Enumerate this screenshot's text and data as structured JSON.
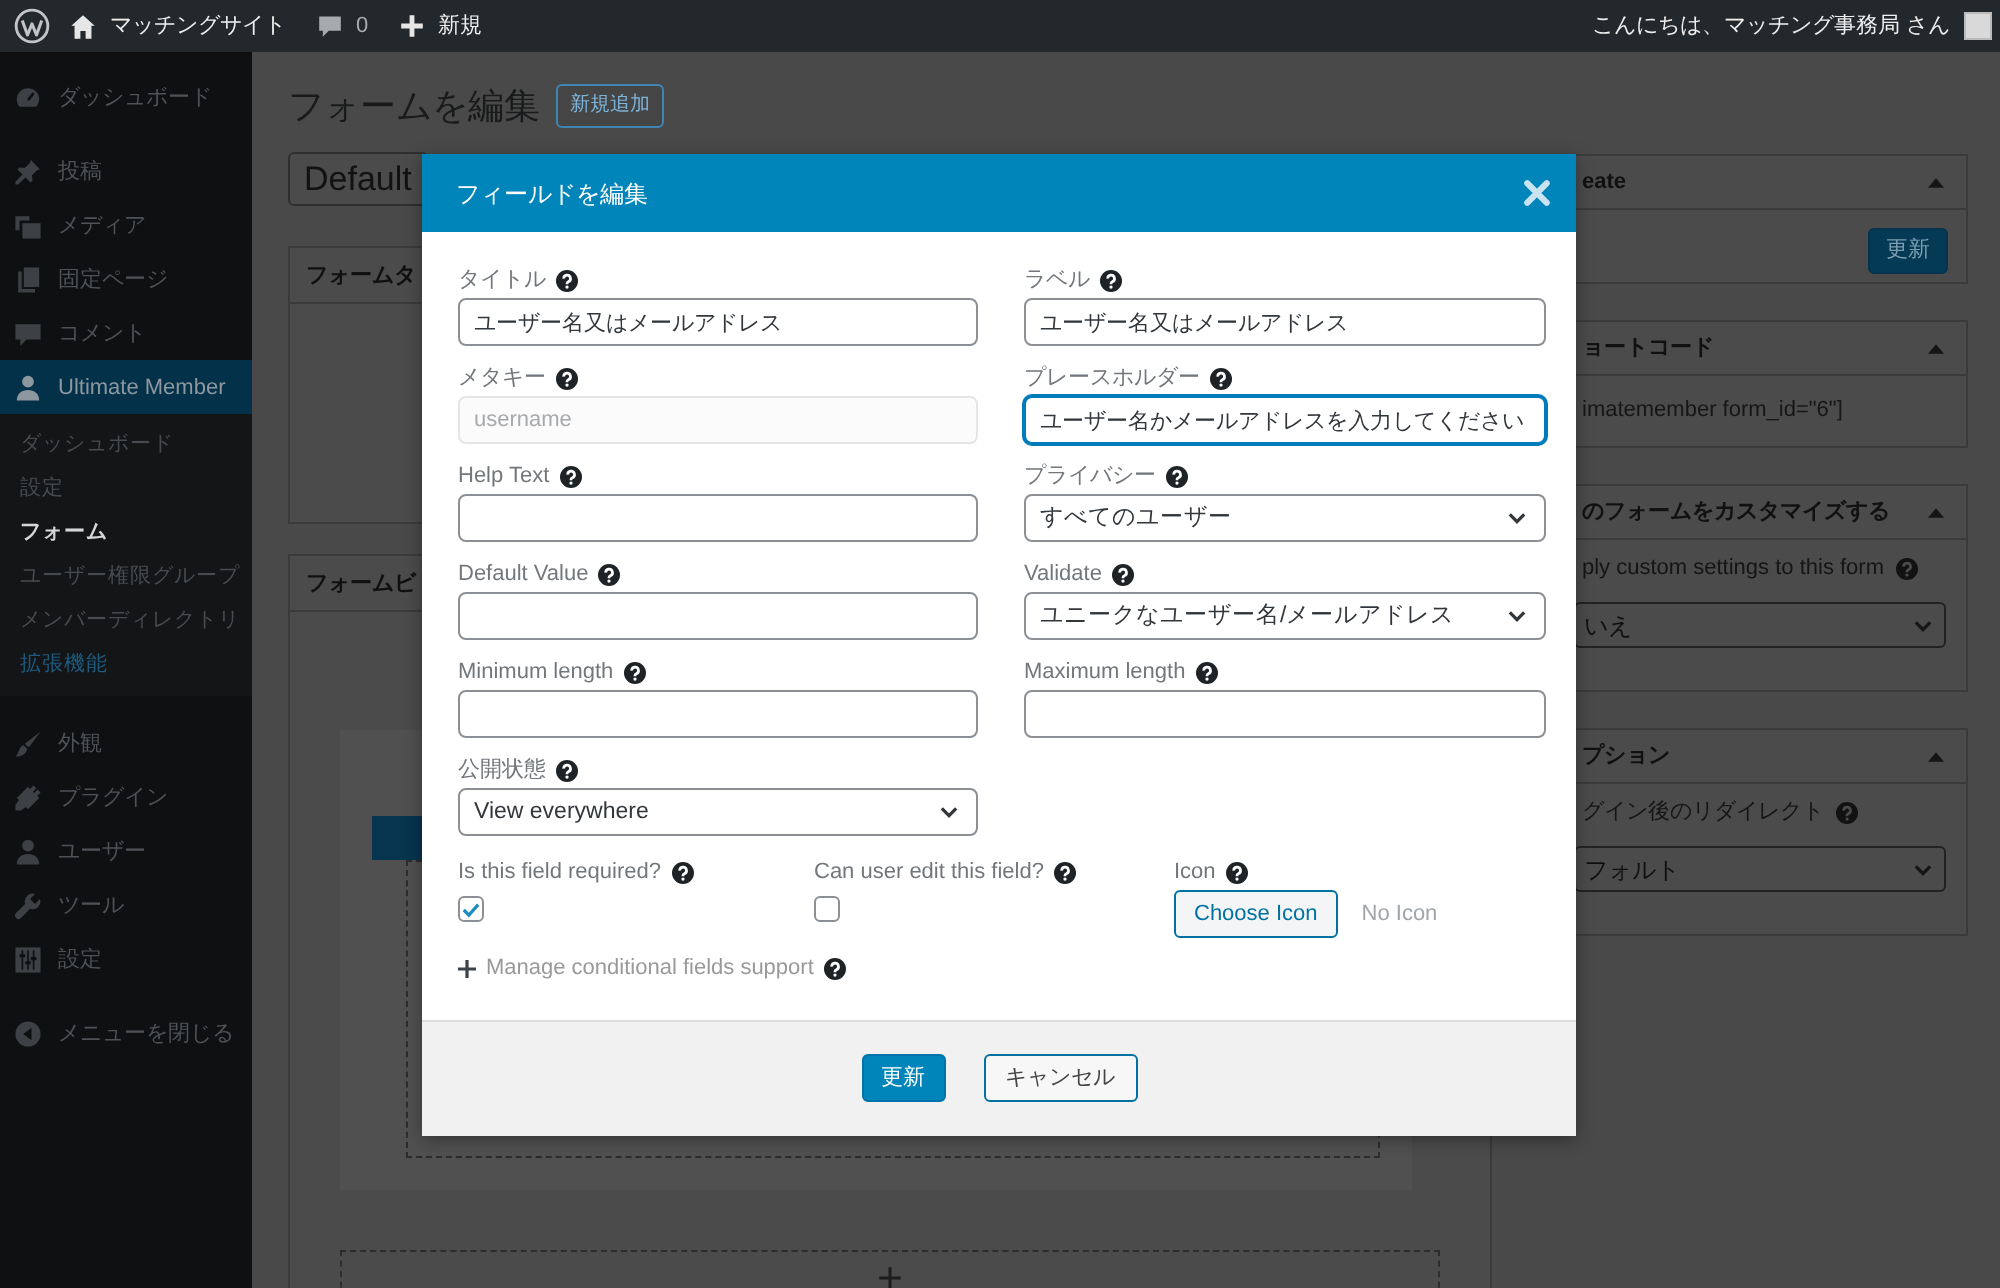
{
  "admin_bar": {
    "site_name": "マッチングサイト",
    "comments": "0",
    "new": "新規",
    "greeting": "こんにちは、マッチング事務局 さん"
  },
  "sidebar": {
    "groups": [
      [
        {
          "label": "ダッシュボード",
          "selected": false
        }
      ],
      [
        {
          "label": "投稿",
          "selected": false
        },
        {
          "label": "メディア",
          "selected": false
        },
        {
          "label": "固定ページ",
          "selected": false
        },
        {
          "label": "コメント",
          "selected": false
        },
        {
          "label": "Ultimate Member",
          "selected": true,
          "children": [
            {
              "label": "ダッシュボード",
              "selected": false,
              "highlighted": false
            },
            {
              "label": "設定",
              "selected": false,
              "highlighted": false
            },
            {
              "label": "フォーム",
              "selected": true,
              "highlighted": false
            },
            {
              "label": "ユーザー権限グループ",
              "selected": false,
              "highlighted": false
            },
            {
              "label": "メンバーディレクトリ",
              "selected": false,
              "highlighted": false
            },
            {
              "label": "拡張機能",
              "selected": false,
              "highlighted": true
            }
          ]
        }
      ],
      [
        {
          "label": "外観",
          "selected": false
        },
        {
          "label": "プラグイン",
          "selected": false
        },
        {
          "label": "ユーザー",
          "selected": false
        },
        {
          "label": "ツール",
          "selected": false
        },
        {
          "label": "設定",
          "selected": false
        }
      ]
    ],
    "collapse": "メニューを閉じる"
  },
  "page": {
    "title": "フォームを編集",
    "add_new": "新規追加",
    "form_title": "Default",
    "panels": [
      {
        "kind": "plain",
        "title": "フォームタ"
      },
      {
        "kind": "builder",
        "title": "フォームビ"
      }
    ]
  },
  "side_panels": [
    {
      "kind": "publish",
      "title": "eate",
      "button": "更新"
    },
    {
      "kind": "text",
      "title": "ョートコード",
      "text": "imatemember form_id=\"6\"]"
    },
    {
      "kind": "select",
      "title": "のフォームをカスタマイズする",
      "label": "ply custom settings to this form",
      "value": "いえ"
    },
    {
      "kind": "select",
      "title": "プション",
      "label": "グイン後のリダイレクト",
      "value": "フォルト"
    }
  ],
  "modal": {
    "title": "フィールドを編集",
    "rows": [
      [
        {
          "kind": "text",
          "label": "タイトル",
          "value": "ユーザー名又はメールアドレス",
          "focused": false,
          "disabled": false
        },
        {
          "kind": "text",
          "label": "ラベル",
          "value": "ユーザー名又はメールアドレス",
          "focused": false,
          "disabled": false
        }
      ],
      [
        {
          "kind": "text",
          "label": "メタキー",
          "value": "username",
          "focused": false,
          "disabled": true
        },
        {
          "kind": "text",
          "label": "プレースホルダー",
          "value": "ユーザー名かメールアドレスを入力してください",
          "focused": true,
          "disabled": false
        }
      ],
      [
        {
          "kind": "text",
          "label": "Help Text",
          "focused": false,
          "disabled": false
        },
        {
          "kind": "select",
          "label": "プライバシー",
          "value": "すべてのユーザー",
          "focused": false,
          "disabled": false
        }
      ],
      [
        {
          "kind": "text",
          "label": "Default Value",
          "focused": false,
          "disabled": false
        },
        {
          "kind": "select",
          "label": "Validate",
          "value": "ユニークなユーザー名/メールアドレス",
          "focused": false,
          "disabled": false
        }
      ],
      [
        {
          "kind": "text",
          "label": "Minimum length",
          "focused": false,
          "disabled": false
        },
        {
          "kind": "text",
          "label": "Maximum length",
          "focused": false,
          "disabled": false
        }
      ],
      [
        {
          "kind": "select",
          "label": "公開状態",
          "value": "View everywhere",
          "focused": false,
          "disabled": false
        }
      ]
    ],
    "options": [
      {
        "kind": "checkbox",
        "label": "Is this field required?",
        "checked": true
      },
      {
        "kind": "checkbox",
        "label": "Can user edit this field?",
        "checked": false
      },
      {
        "kind": "icon_picker",
        "label": "Icon",
        "button": "Choose Icon",
        "value": "No Icon"
      }
    ],
    "conditional": "Manage conditional fields support",
    "buttons": [
      {
        "kind": "primary",
        "label": "更新"
      },
      {
        "kind": "secondary",
        "label": "キャンセル"
      }
    ]
  }
}
